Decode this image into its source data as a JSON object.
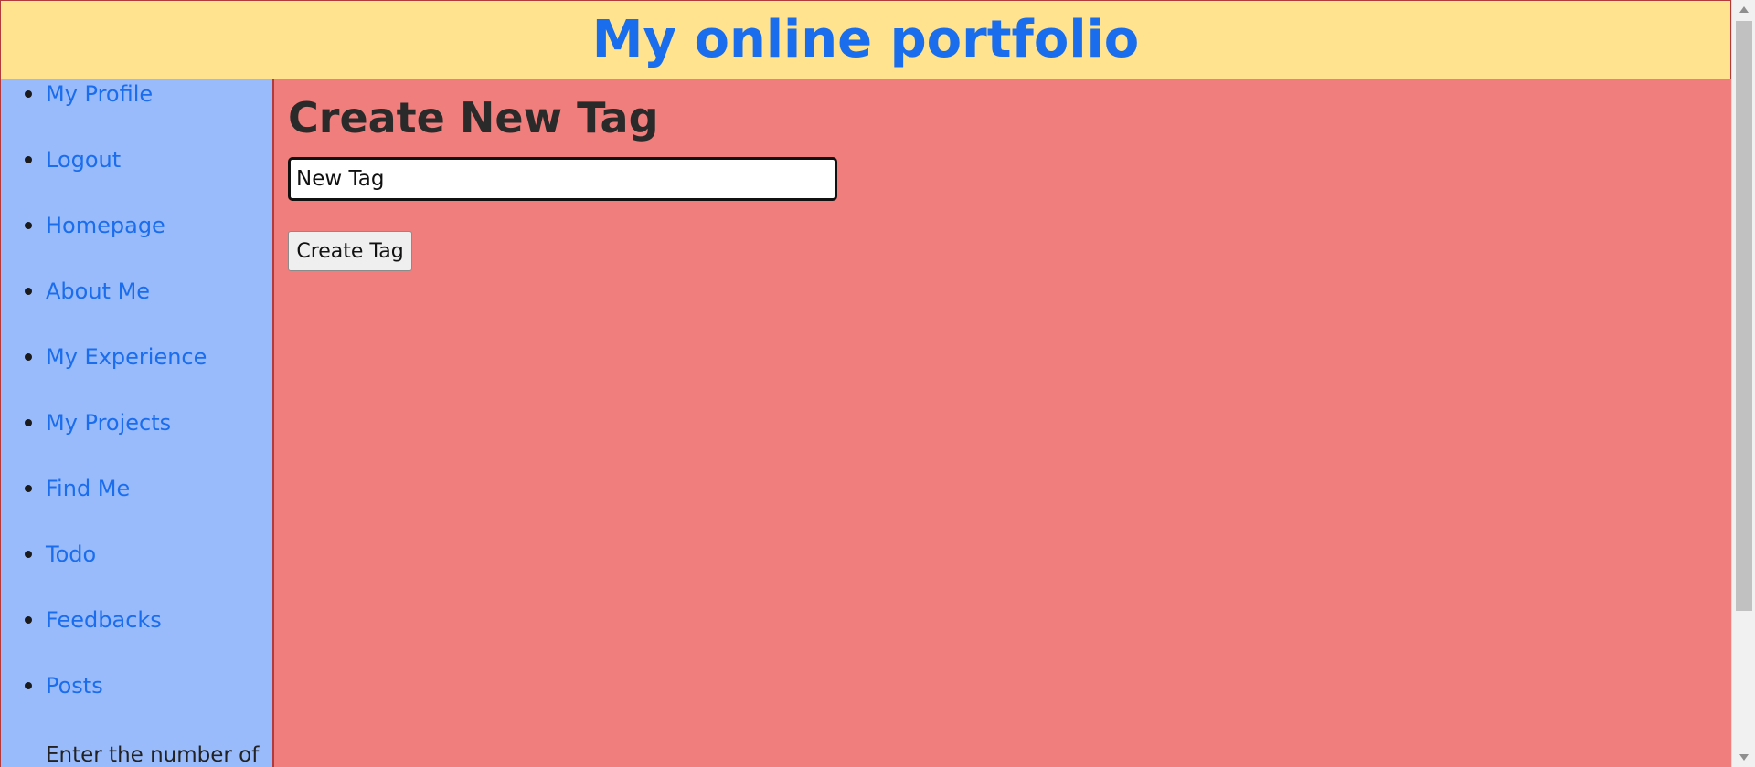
{
  "header": {
    "title": "My online portfolio"
  },
  "sidebar": {
    "items": [
      {
        "label": "My Profile"
      },
      {
        "label": "Logout"
      },
      {
        "label": "Homepage"
      },
      {
        "label": "About Me"
      },
      {
        "label": "My Experience"
      },
      {
        "label": "My Projects"
      },
      {
        "label": "Find Me"
      },
      {
        "label": "Todo"
      },
      {
        "label": "Feedbacks"
      },
      {
        "label": "Posts"
      }
    ],
    "note": "Enter the number of"
  },
  "main": {
    "title": "Create New Tag",
    "tag_input": {
      "value": "New Tag"
    },
    "create_button": "Create Tag"
  },
  "colors": {
    "header_background": "#ffe38f",
    "link": "#1a6ded",
    "sidebar_background": "#99bbfb",
    "main_background": "#ef7e7d",
    "border": "#b33a3a"
  },
  "icons": {
    "bullet": "bullet-icon",
    "scroll_up": "scroll-up-icon",
    "scroll_down": "scroll-down-icon"
  }
}
